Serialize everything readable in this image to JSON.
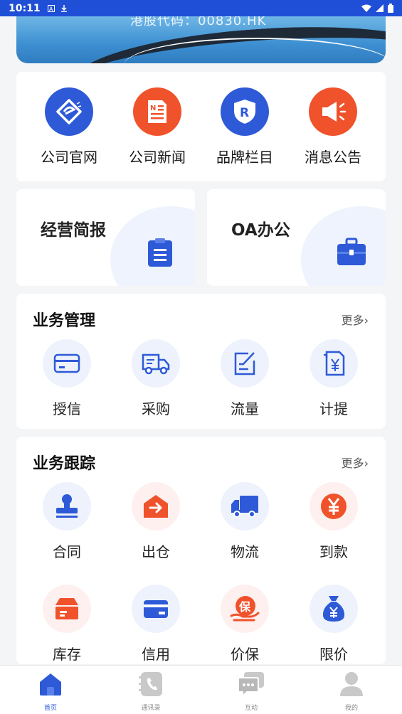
{
  "status_bar": {
    "time": "10:11"
  },
  "banner": {
    "stock_text": "港股代码：00830.HK"
  },
  "quick_links": [
    {
      "label": "公司官网",
      "icon": "compass-e-icon",
      "color": "#2e5ad8"
    },
    {
      "label": "公司新闻",
      "icon": "news-icon",
      "color": "#f0522b"
    },
    {
      "label": "品牌栏目",
      "icon": "shield-r-icon",
      "color": "#2e5ad8"
    },
    {
      "label": "消息公告",
      "icon": "speaker-icon",
      "color": "#f0522b"
    }
  ],
  "feature_cards": [
    {
      "label": "经营简报",
      "icon": "clipboard-icon"
    },
    {
      "label": "OA办公",
      "icon": "briefcase-icon"
    }
  ],
  "business_mgmt": {
    "title": "业务管理",
    "more": "更多›",
    "items": [
      {
        "label": "授信",
        "icon": "card-icon"
      },
      {
        "label": "采购",
        "icon": "truck-icon"
      },
      {
        "label": "流量",
        "icon": "edit-doc-icon"
      },
      {
        "label": "计提",
        "icon": "yen-doc-icon"
      }
    ]
  },
  "business_track": {
    "title": "业务跟踪",
    "more": "更多›",
    "items": [
      {
        "label": "合同",
        "icon": "stamp-icon"
      },
      {
        "label": "出仓",
        "icon": "warehouse-out-icon"
      },
      {
        "label": "物流",
        "icon": "lorry-icon"
      },
      {
        "label": "到款",
        "icon": "yen-coin-icon"
      },
      {
        "label": "库存",
        "icon": "box-icon"
      },
      {
        "label": "信用",
        "icon": "credit-card-icon"
      },
      {
        "label": "价保",
        "icon": "price-protect-icon"
      },
      {
        "label": "限价",
        "icon": "money-bag-icon"
      }
    ]
  },
  "tabs": [
    {
      "label": "首页",
      "active": true
    },
    {
      "label": "通讯录",
      "active": false
    },
    {
      "label": "互动",
      "active": false
    },
    {
      "label": "我的",
      "active": false
    }
  ],
  "colors": {
    "primary": "#2e5ad8",
    "accent": "#f0522b",
    "background": "#f4f5f7"
  }
}
